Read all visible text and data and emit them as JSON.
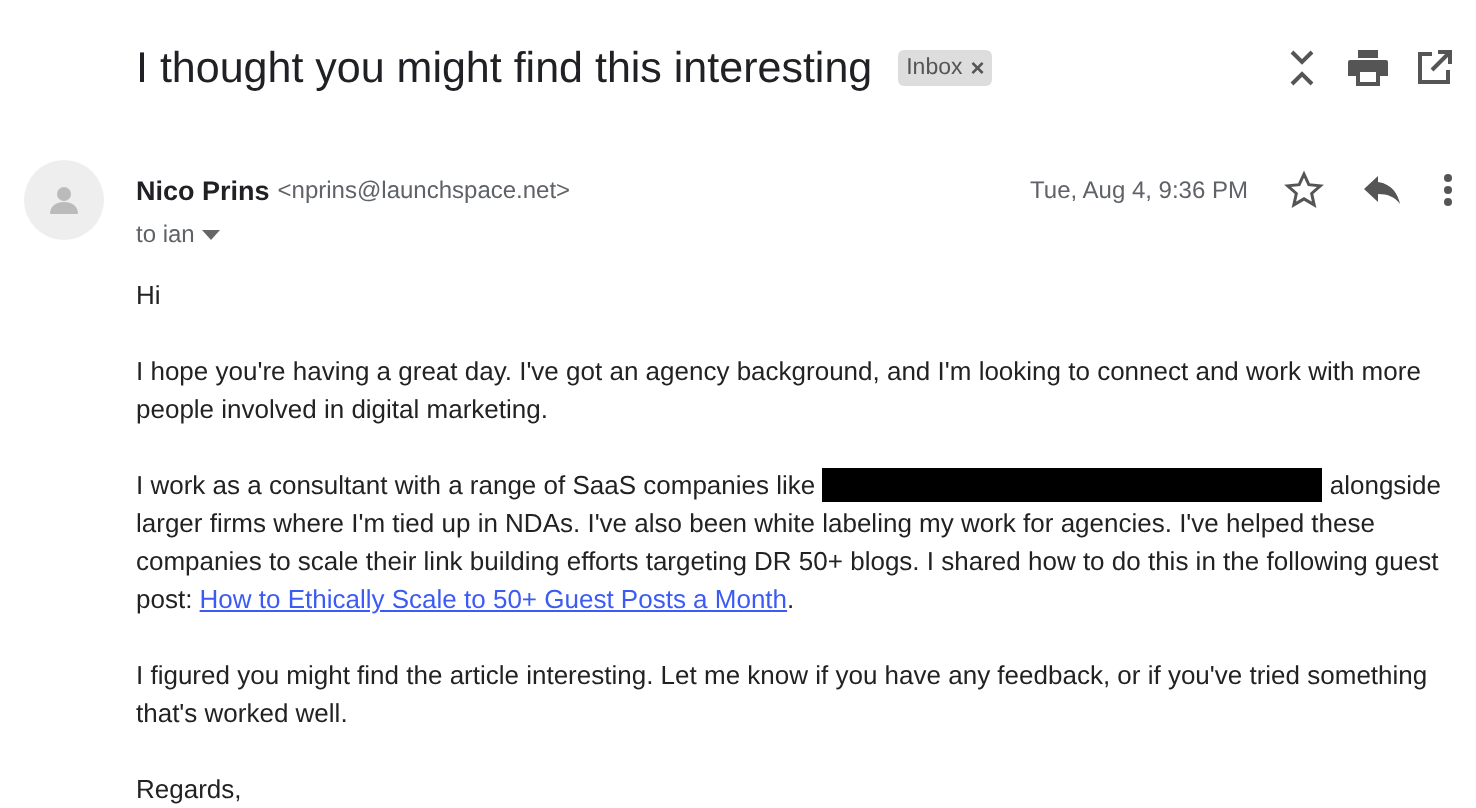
{
  "subject": "I thought you might find this interesting",
  "label": {
    "text": "Inbox",
    "close": "×"
  },
  "sender": {
    "name": "Nico Prins",
    "email": "<nprins@launchspace.net>",
    "to": "to ian",
    "date": "Tue, Aug 4, 9:36 PM",
    "starred": false
  },
  "body": [
    {
      "segments": [
        {
          "kind": "text",
          "text": "Hi"
        }
      ]
    },
    {
      "segments": [
        {
          "kind": "text",
          "text": "I hope you're having a great day. I've got an agency background, and I'm looking to connect and work with more\npeople involved in digital marketing."
        }
      ]
    },
    {
      "segments": [
        {
          "kind": "text",
          "text": "I work as a consultant with a range of SaaS companies like "
        },
        {
          "kind": "redacted"
        },
        {
          "kind": "text",
          "text": " alongside\nlarger firms where I'm tied up in NDAs. I've also been white labeling my work for agencies. I've helped these\ncompanies to scale their link building efforts targeting DR 50+ blogs. I shared how to do this in the following guest\npost: "
        },
        {
          "kind": "link",
          "text": "How to Ethically Scale to 50+ Guest Posts a Month"
        },
        {
          "kind": "text",
          "text": "."
        }
      ]
    },
    {
      "segments": [
        {
          "kind": "text",
          "text": "I figured you might find the article interesting. Let me know if you have any feedback, or if you've tried something\nthat's worked well."
        }
      ]
    },
    {
      "segments": [
        {
          "kind": "text",
          "text": "Regards,"
        }
      ]
    }
  ]
}
